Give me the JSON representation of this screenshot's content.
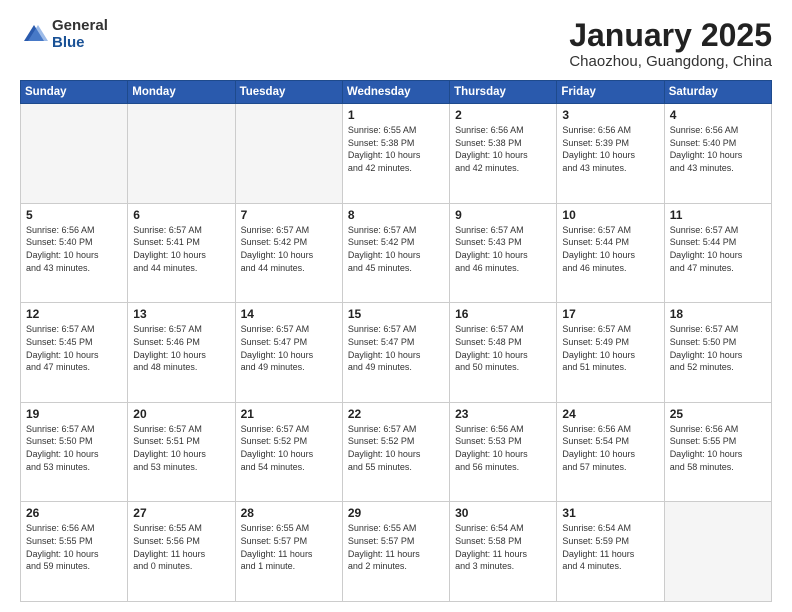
{
  "header": {
    "logo_general": "General",
    "logo_blue": "Blue",
    "month_title": "January 2025",
    "subtitle": "Chaozhou, Guangdong, China"
  },
  "days_of_week": [
    "Sunday",
    "Monday",
    "Tuesday",
    "Wednesday",
    "Thursday",
    "Friday",
    "Saturday"
  ],
  "weeks": [
    [
      {
        "day": "",
        "info": ""
      },
      {
        "day": "",
        "info": ""
      },
      {
        "day": "",
        "info": ""
      },
      {
        "day": "1",
        "info": "Sunrise: 6:55 AM\nSunset: 5:38 PM\nDaylight: 10 hours\nand 42 minutes."
      },
      {
        "day": "2",
        "info": "Sunrise: 6:56 AM\nSunset: 5:38 PM\nDaylight: 10 hours\nand 42 minutes."
      },
      {
        "day": "3",
        "info": "Sunrise: 6:56 AM\nSunset: 5:39 PM\nDaylight: 10 hours\nand 43 minutes."
      },
      {
        "day": "4",
        "info": "Sunrise: 6:56 AM\nSunset: 5:40 PM\nDaylight: 10 hours\nand 43 minutes."
      }
    ],
    [
      {
        "day": "5",
        "info": "Sunrise: 6:56 AM\nSunset: 5:40 PM\nDaylight: 10 hours\nand 43 minutes."
      },
      {
        "day": "6",
        "info": "Sunrise: 6:57 AM\nSunset: 5:41 PM\nDaylight: 10 hours\nand 44 minutes."
      },
      {
        "day": "7",
        "info": "Sunrise: 6:57 AM\nSunset: 5:42 PM\nDaylight: 10 hours\nand 44 minutes."
      },
      {
        "day": "8",
        "info": "Sunrise: 6:57 AM\nSunset: 5:42 PM\nDaylight: 10 hours\nand 45 minutes."
      },
      {
        "day": "9",
        "info": "Sunrise: 6:57 AM\nSunset: 5:43 PM\nDaylight: 10 hours\nand 46 minutes."
      },
      {
        "day": "10",
        "info": "Sunrise: 6:57 AM\nSunset: 5:44 PM\nDaylight: 10 hours\nand 46 minutes."
      },
      {
        "day": "11",
        "info": "Sunrise: 6:57 AM\nSunset: 5:44 PM\nDaylight: 10 hours\nand 47 minutes."
      }
    ],
    [
      {
        "day": "12",
        "info": "Sunrise: 6:57 AM\nSunset: 5:45 PM\nDaylight: 10 hours\nand 47 minutes."
      },
      {
        "day": "13",
        "info": "Sunrise: 6:57 AM\nSunset: 5:46 PM\nDaylight: 10 hours\nand 48 minutes."
      },
      {
        "day": "14",
        "info": "Sunrise: 6:57 AM\nSunset: 5:47 PM\nDaylight: 10 hours\nand 49 minutes."
      },
      {
        "day": "15",
        "info": "Sunrise: 6:57 AM\nSunset: 5:47 PM\nDaylight: 10 hours\nand 49 minutes."
      },
      {
        "day": "16",
        "info": "Sunrise: 6:57 AM\nSunset: 5:48 PM\nDaylight: 10 hours\nand 50 minutes."
      },
      {
        "day": "17",
        "info": "Sunrise: 6:57 AM\nSunset: 5:49 PM\nDaylight: 10 hours\nand 51 minutes."
      },
      {
        "day": "18",
        "info": "Sunrise: 6:57 AM\nSunset: 5:50 PM\nDaylight: 10 hours\nand 52 minutes."
      }
    ],
    [
      {
        "day": "19",
        "info": "Sunrise: 6:57 AM\nSunset: 5:50 PM\nDaylight: 10 hours\nand 53 minutes."
      },
      {
        "day": "20",
        "info": "Sunrise: 6:57 AM\nSunset: 5:51 PM\nDaylight: 10 hours\nand 53 minutes."
      },
      {
        "day": "21",
        "info": "Sunrise: 6:57 AM\nSunset: 5:52 PM\nDaylight: 10 hours\nand 54 minutes."
      },
      {
        "day": "22",
        "info": "Sunrise: 6:57 AM\nSunset: 5:52 PM\nDaylight: 10 hours\nand 55 minutes."
      },
      {
        "day": "23",
        "info": "Sunrise: 6:56 AM\nSunset: 5:53 PM\nDaylight: 10 hours\nand 56 minutes."
      },
      {
        "day": "24",
        "info": "Sunrise: 6:56 AM\nSunset: 5:54 PM\nDaylight: 10 hours\nand 57 minutes."
      },
      {
        "day": "25",
        "info": "Sunrise: 6:56 AM\nSunset: 5:55 PM\nDaylight: 10 hours\nand 58 minutes."
      }
    ],
    [
      {
        "day": "26",
        "info": "Sunrise: 6:56 AM\nSunset: 5:55 PM\nDaylight: 10 hours\nand 59 minutes."
      },
      {
        "day": "27",
        "info": "Sunrise: 6:55 AM\nSunset: 5:56 PM\nDaylight: 11 hours\nand 0 minutes."
      },
      {
        "day": "28",
        "info": "Sunrise: 6:55 AM\nSunset: 5:57 PM\nDaylight: 11 hours\nand 1 minute."
      },
      {
        "day": "29",
        "info": "Sunrise: 6:55 AM\nSunset: 5:57 PM\nDaylight: 11 hours\nand 2 minutes."
      },
      {
        "day": "30",
        "info": "Sunrise: 6:54 AM\nSunset: 5:58 PM\nDaylight: 11 hours\nand 3 minutes."
      },
      {
        "day": "31",
        "info": "Sunrise: 6:54 AM\nSunset: 5:59 PM\nDaylight: 11 hours\nand 4 minutes."
      },
      {
        "day": "",
        "info": ""
      }
    ]
  ]
}
